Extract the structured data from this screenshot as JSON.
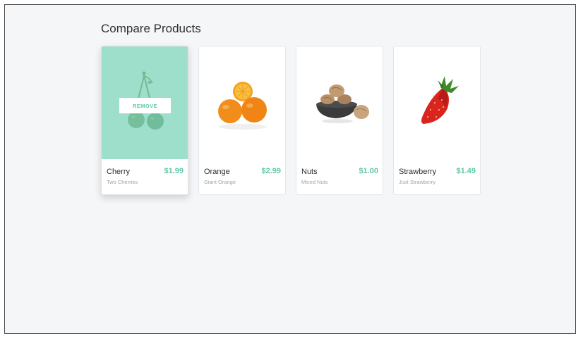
{
  "page": {
    "title": "Compare Products"
  },
  "colors": {
    "accent": "#5fc7a9",
    "overlay": "#78d2b8",
    "background": "#f5f6f8"
  },
  "products": [
    {
      "name": "Cherry",
      "price": "$1.99",
      "subtitle": "Two Cherries",
      "image_icon": "cherry-icon",
      "hovered": true,
      "remove_label": "REMOVE"
    },
    {
      "name": "Orange",
      "price": "$2.99",
      "subtitle": "Giant Orange",
      "image_icon": "orange-icon"
    },
    {
      "name": "Nuts",
      "price": "$1.00",
      "subtitle": "Mixed Nuts",
      "image_icon": "nuts-icon"
    },
    {
      "name": "Strawberry",
      "price": "$1.49",
      "subtitle": "Just Strawberry",
      "image_icon": "strawberry-icon"
    }
  ]
}
